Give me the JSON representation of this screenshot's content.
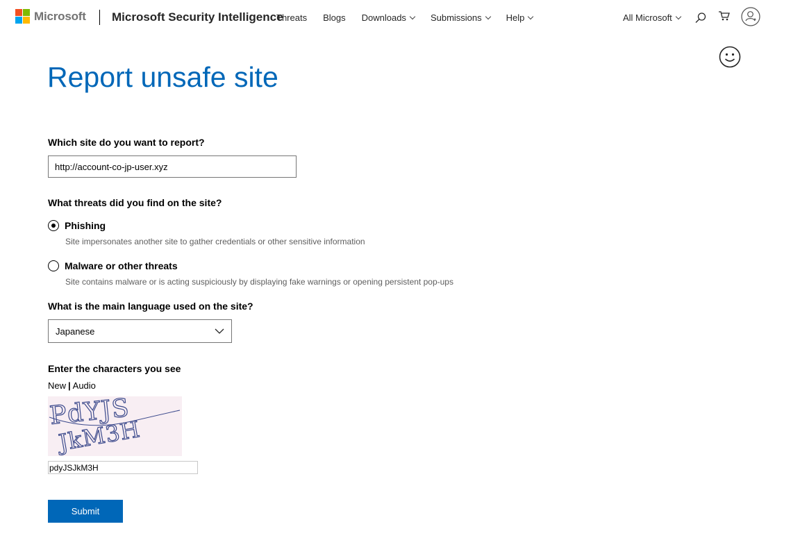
{
  "header": {
    "brand": "Microsoft",
    "site_title": "Microsoft Security Intelligence",
    "nav": [
      {
        "label": "Threats",
        "has_dropdown": false
      },
      {
        "label": "Blogs",
        "has_dropdown": false
      },
      {
        "label": "Downloads",
        "has_dropdown": true
      },
      {
        "label": "Submissions",
        "has_dropdown": true
      },
      {
        "label": "Help",
        "has_dropdown": true
      }
    ],
    "all_microsoft": "All Microsoft",
    "icons": [
      "search-icon",
      "cart-icon",
      "account-icon"
    ],
    "logo_colors": [
      "#f25022",
      "#7fba00",
      "#00a4ef",
      "#ffb900"
    ]
  },
  "feedback_icon": "smiley-icon",
  "page_title": "Report unsafe site",
  "form": {
    "site_question": "Which site do you want to report?",
    "site_value": "http://account-co-jp-user.xyz",
    "threats_question": "What threats did you find on the site?",
    "threat_options": [
      {
        "label": "Phishing",
        "description": "Site impersonates another site to gather credentials or other sensitive information",
        "checked": true
      },
      {
        "label": "Malware or other threats",
        "description": "Site contains malware or is acting suspiciously by displaying fake warnings or opening persistent pop-ups",
        "checked": false
      }
    ],
    "language_question": "What is the main language used on the site?",
    "language_selected": "Japanese",
    "captcha_label": "Enter the characters you see",
    "captcha_new": "New",
    "captcha_separator": "|",
    "captcha_audio": "Audio",
    "captcha_image_text_line1": "PdYJS",
    "captcha_image_text_line2": "JkM3H",
    "captcha_value": "pdyJSJkM3H",
    "submit_label": "Submit"
  },
  "colors": {
    "accent": "#0067b8",
    "captcha_ink": "#3c4a8c",
    "captcha_bg": "#f8eef3"
  }
}
